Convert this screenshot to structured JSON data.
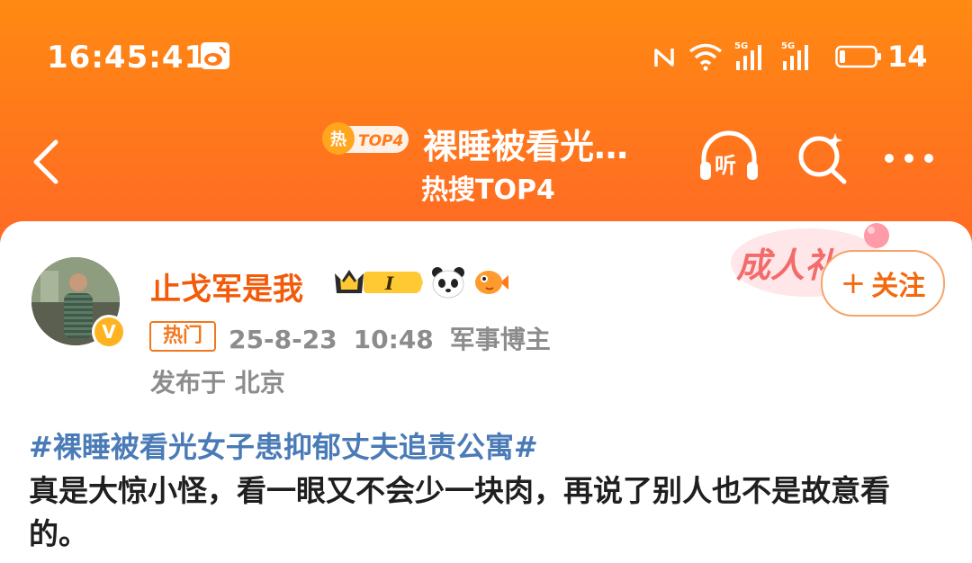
{
  "status_bar": {
    "time": "16:45:41",
    "battery_level": "14"
  },
  "nav": {
    "hot_badge_label": "TOP4",
    "title": "裸睡被看光…",
    "subtitle": "热搜TOP4",
    "listen_label": "听"
  },
  "post": {
    "username": "止戈军是我",
    "level_badge": "I",
    "hot_tag": "热门",
    "date": "25-8-23",
    "time": "10:48",
    "role": "军事博主",
    "location": "发布于 北京",
    "follow_label": "关注",
    "hashtag": "#裸睡被看光女子患抑郁丈夫追责公寓#",
    "text": "真是大惊小怪，看一眼又不会少一块肉，再说了别人也不是故意看的。",
    "sticker_text": "成人礼"
  },
  "colors": {
    "header_orange": "#ff7a1a",
    "username_orange": "#f25b0a",
    "hashtag_blue": "#4a7bb7",
    "meta_gray": "#8c8c8c"
  }
}
